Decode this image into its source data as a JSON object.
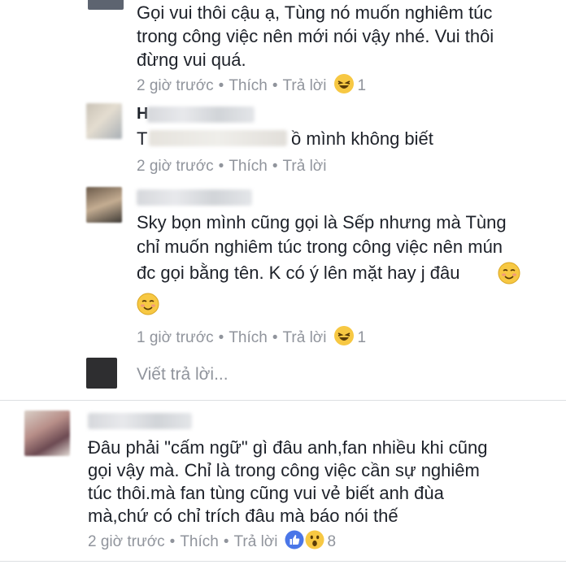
{
  "comment1": {
    "lines": [
      "Gọi vui thôi cậu ạ, Tùng nó muốn nghiêm túc",
      "trong công việc nên mới nói vậy nhé. Vui thôi",
      "đừng vui quá."
    ],
    "time": "2 giờ trước",
    "like": "Thích",
    "reply": "Trả lời",
    "reaction_count": "1"
  },
  "comment2": {
    "name_initial": "H",
    "tag_initial": "T",
    "text": "ồ mình không biết",
    "time": "2 giờ trước",
    "like": "Thích",
    "reply": "Trả lời"
  },
  "comment3": {
    "lines": [
      "Sky bọn mình cũng gọi là Sếp nhưng mà Tùng",
      "chỉ muốn nghiêm túc trong công việc nên mún",
      "đc gọi bằng tên. K có ý lên mặt hay j đâu"
    ],
    "time": "1 giờ trước",
    "like": "Thích",
    "reply": "Trả lời",
    "reaction_count": "1"
  },
  "reply_box": {
    "placeholder": "Viết trả lời..."
  },
  "comment4": {
    "lines": [
      "Đâu phải \"cấm ngữ\" gì đâu anh,fan nhiều khi cũng",
      "gọi vậy mà. Chỉ là trong công việc cần sự nghiêm",
      "túc thôi.mà fan tùng cũng vui vẻ biết anh đùa",
      "mà,chứ có chỉ trích đâu mà báo nói thế"
    ],
    "time": "2 giờ trước",
    "like": "Thích",
    "reply": "Trả lời",
    "reaction_count": "8"
  },
  "separator": "•",
  "colors": {
    "text": "#1d2129",
    "meta": "#90949c",
    "like_blue": "#4a76e8",
    "emoji_yellow": "#f7c843"
  }
}
